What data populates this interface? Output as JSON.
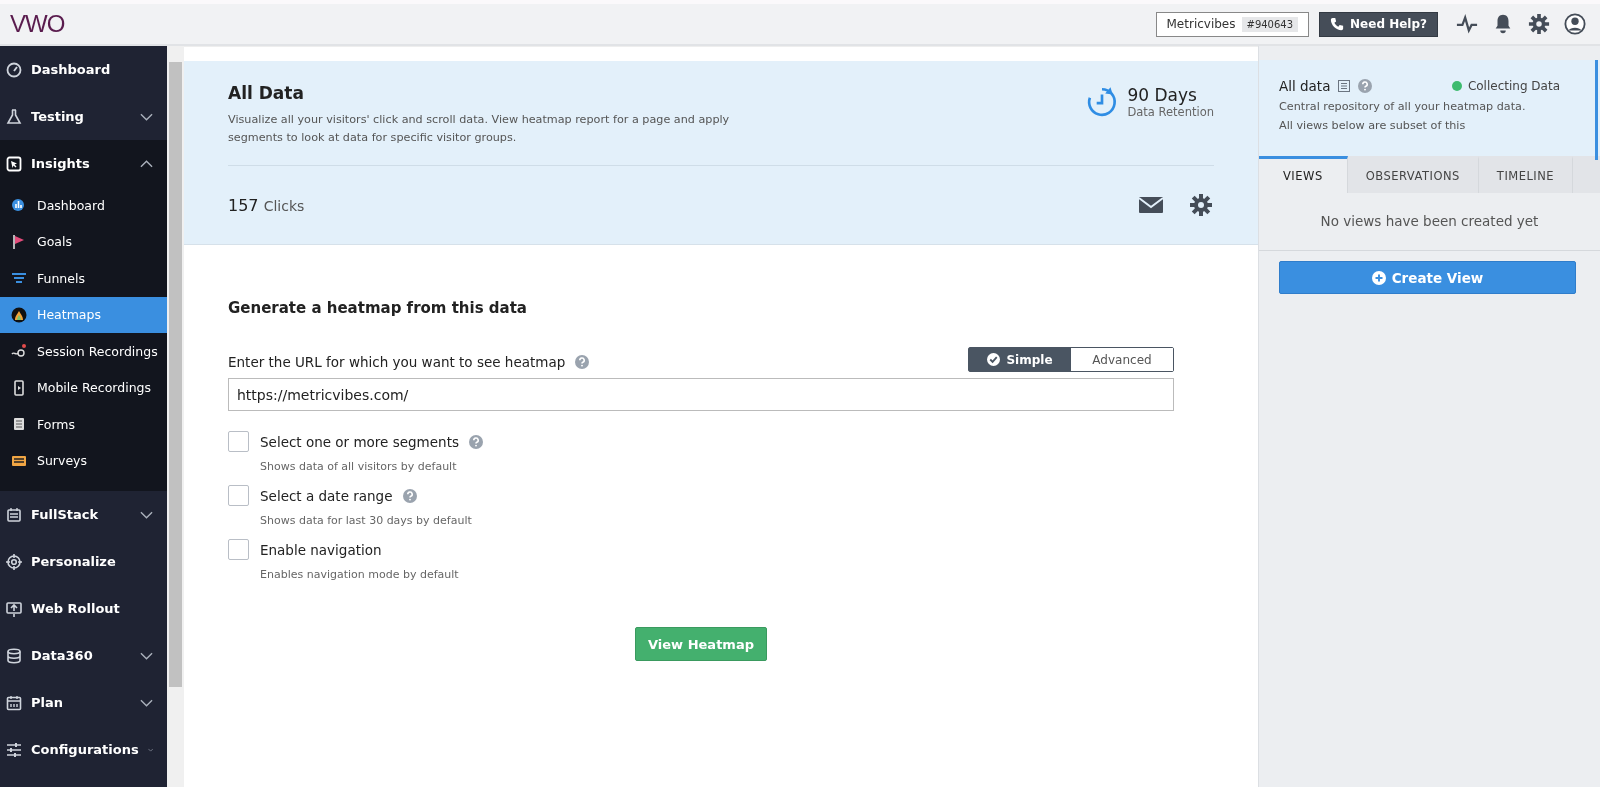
{
  "topbar": {
    "logo": "VWO",
    "account": {
      "name": "Metricvibes",
      "id": "#940643"
    },
    "help_button": "Need Help?"
  },
  "sidebar": {
    "items": [
      {
        "label": "Dashboard",
        "selected": false
      },
      {
        "label": "Testing",
        "selected": false,
        "expanded": false
      },
      {
        "label": "Insights",
        "selected": false,
        "expanded": true,
        "children": [
          {
            "label": "Dashboard",
            "selected": false
          },
          {
            "label": "Goals",
            "selected": false
          },
          {
            "label": "Funnels",
            "selected": false
          },
          {
            "label": "Heatmaps",
            "selected": true
          },
          {
            "label": "Session Recordings",
            "selected": false
          },
          {
            "label": "Mobile Recordings",
            "selected": false
          },
          {
            "label": "Forms",
            "selected": false
          },
          {
            "label": "Surveys",
            "selected": false
          }
        ]
      },
      {
        "label": "FullStack",
        "selected": false,
        "expanded": false
      },
      {
        "label": "Personalize",
        "selected": false
      },
      {
        "label": "Web Rollout",
        "selected": false
      },
      {
        "label": "Data360",
        "selected": false,
        "expanded": false
      },
      {
        "label": "Plan",
        "selected": false,
        "expanded": false
      },
      {
        "label": "Configurations",
        "selected": false,
        "expanded": false
      }
    ]
  },
  "header": {
    "title": "All Data",
    "description": "Visualize all your visitors' click and scroll data. View heatmap report for a page and apply segments to look at data for specific visitor groups.",
    "retention": {
      "value": "90 Days",
      "label": "Data Retention"
    },
    "clicks": {
      "count": "157",
      "label": "Clicks"
    }
  },
  "form": {
    "heading": "Generate a heatmap from this data",
    "url_label": "Enter the URL for which you want to see heatmap",
    "modes": [
      {
        "label": "Simple",
        "selected": true
      },
      {
        "label": "Advanced",
        "selected": false
      }
    ],
    "url": "https://metricvibes.com/",
    "options": [
      {
        "label": "Select one or more segments",
        "hint": "Shows data of all visitors by default",
        "checked": false,
        "help": true
      },
      {
        "label": "Select a date range",
        "hint": "Shows data for last 30 days by default",
        "checked": false,
        "help": true
      },
      {
        "label": "Enable navigation",
        "hint": "Enables navigation mode by default",
        "checked": false,
        "help": false
      }
    ],
    "submit": "View Heatmap"
  },
  "panel": {
    "title": "All data",
    "status": {
      "label": "Collecting Data",
      "color": "#3dbb6e"
    },
    "description": [
      "Central repository of all your heatmap data.",
      "All views below are subset of this"
    ],
    "tabs": [
      {
        "label": "VIEWS",
        "selected": true
      },
      {
        "label": "OBSERVATIONS",
        "selected": false
      },
      {
        "label": "TIMELINE",
        "selected": false
      }
    ],
    "empty": "No views have been created yet",
    "create_button": "Create View"
  }
}
